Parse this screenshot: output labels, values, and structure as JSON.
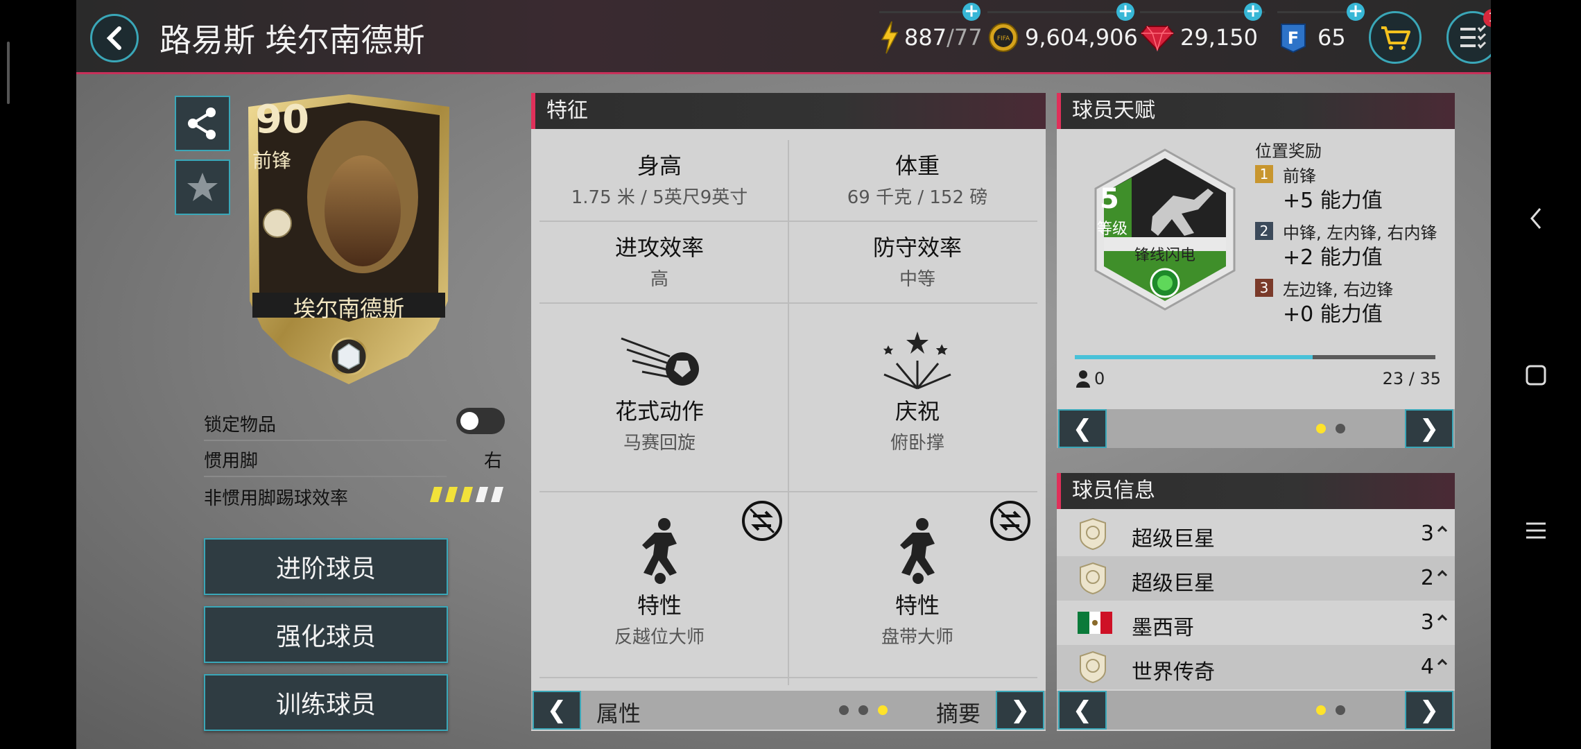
{
  "header": {
    "title": "路易斯 埃尔南德斯",
    "energy": {
      "value": "887",
      "max": "/77"
    },
    "coins": "9,604,906",
    "gems": "29,150",
    "fifa_points": "65",
    "menu_badge": "1"
  },
  "card": {
    "rating": "90",
    "position": "前锋",
    "name": "埃尔南德斯"
  },
  "left": {
    "lock_label": "锁定物品",
    "preferred_foot_label": "惯用脚",
    "preferred_foot_value": "右",
    "weak_foot_label": "非惯用脚踢球效率",
    "weak_foot_stars": 3,
    "buttons": [
      "进阶球员",
      "强化球员",
      "训练球员"
    ]
  },
  "traits": {
    "title": "特征",
    "cells": [
      {
        "title": "身高",
        "value": "1.75 米 / 5英尺9英寸"
      },
      {
        "title": "体重",
        "value": "69 千克 / 152 磅"
      },
      {
        "title": "进攻效率",
        "value": "高"
      },
      {
        "title": "防守效率",
        "value": "中等"
      },
      {
        "title": "花式动作",
        "value": "马赛回旋"
      },
      {
        "title": "庆祝",
        "value": "俯卧撑"
      },
      {
        "title": "特性",
        "value": "反越位大师"
      },
      {
        "title": "特性",
        "value": "盘带大师"
      }
    ],
    "footer_left": "属性",
    "footer_right": "摘要",
    "prev": "❮",
    "next": "❯"
  },
  "talent": {
    "title": "球员天赋",
    "level": "5",
    "level_label": "等级",
    "skill_name": "锋线闪电",
    "bonus_title": "位置奖励",
    "bonuses": [
      {
        "rank": "1",
        "positions": "前锋",
        "value": "+5 能力值",
        "color": "#c8962e"
      },
      {
        "rank": "2",
        "positions": "中锋, 左内锋, 右内锋",
        "value": "+2 能力值",
        "color": "#3c4a5a"
      },
      {
        "rank": "3",
        "positions": "左边锋, 右边锋",
        "value": "+0 能力值",
        "color": "#7a3a2a"
      }
    ],
    "progress": 0.66,
    "points": "0",
    "progress_text": "23 / 35",
    "prev": "❮",
    "next": "❯"
  },
  "info": {
    "title": "球员信息",
    "rows": [
      {
        "label": "超级巨星",
        "value": "3",
        "icon": "icon-badge"
      },
      {
        "label": "超级巨星",
        "value": "2",
        "icon": "icon-badge"
      },
      {
        "label": "墨西哥",
        "value": "3",
        "icon": "mexico-flag"
      },
      {
        "label": "世界传奇",
        "value": "4",
        "icon": "icon-badge"
      }
    ],
    "prev": "❮",
    "next": "❯"
  },
  "colors": {
    "accent": "#3aa7b8",
    "header_accent": "#e0305a",
    "dot_active": "#ffe32a",
    "progress": "#48c1d8"
  }
}
